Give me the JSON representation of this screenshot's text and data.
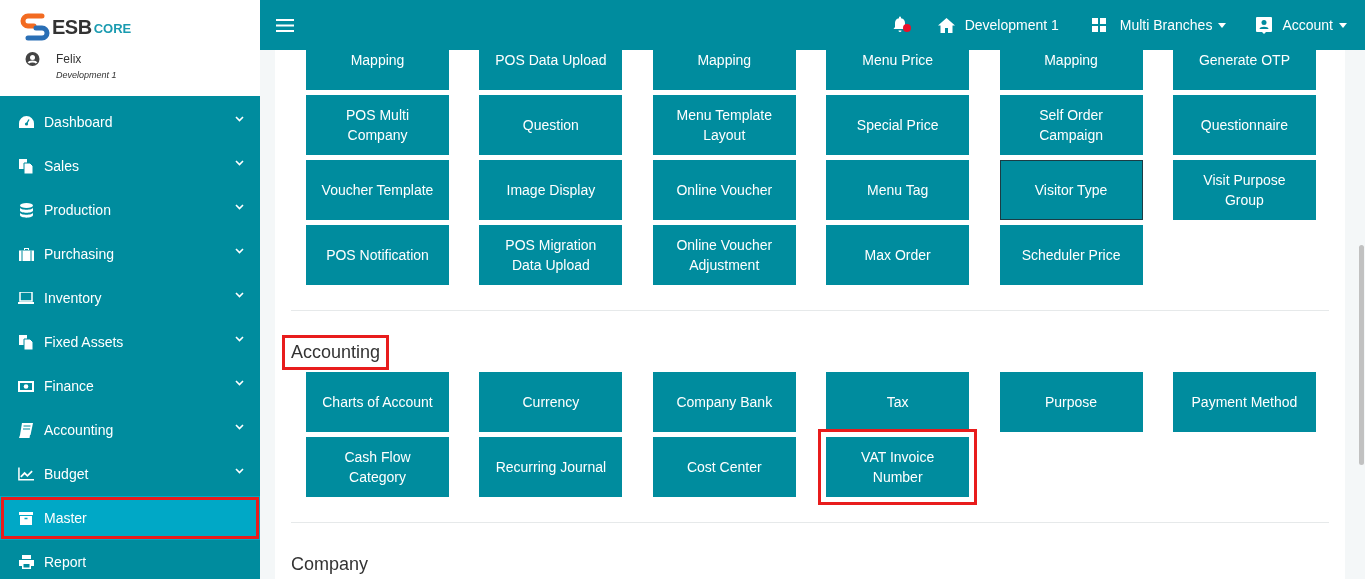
{
  "logo": {
    "text_main": "ESB",
    "text_sub": "CORE"
  },
  "user": {
    "name": "Felix",
    "branch": "Development 1"
  },
  "sidebar": {
    "items": [
      {
        "label": "Dashboard",
        "expandable": true,
        "selected": false,
        "highlighted": false
      },
      {
        "label": "Sales",
        "expandable": true,
        "selected": false,
        "highlighted": false
      },
      {
        "label": "Production",
        "expandable": true,
        "selected": false,
        "highlighted": false
      },
      {
        "label": "Purchasing",
        "expandable": true,
        "selected": false,
        "highlighted": false
      },
      {
        "label": "Inventory",
        "expandable": true,
        "selected": false,
        "highlighted": false
      },
      {
        "label": "Fixed Assets",
        "expandable": true,
        "selected": false,
        "highlighted": false
      },
      {
        "label": "Finance",
        "expandable": true,
        "selected": false,
        "highlighted": false
      },
      {
        "label": "Accounting",
        "expandable": true,
        "selected": false,
        "highlighted": false
      },
      {
        "label": "Budget",
        "expandable": true,
        "selected": false,
        "highlighted": false
      },
      {
        "label": "Master",
        "expandable": false,
        "selected": true,
        "highlighted": true
      },
      {
        "label": "Report",
        "expandable": false,
        "selected": false,
        "highlighted": false
      }
    ]
  },
  "header": {
    "notifications": {
      "unread": true
    },
    "branch": "Development 1",
    "branches_menu": "Multi Branches",
    "account_menu": "Account"
  },
  "sections": [
    {
      "tiles": [
        {
          "label": "Mapping",
          "focused": false,
          "highlighted": false
        },
        {
          "label": "POS Data Upload",
          "focused": false,
          "highlighted": false
        },
        {
          "label": "Mapping",
          "focused": false,
          "highlighted": false
        },
        {
          "label": "Menu Price",
          "focused": false,
          "highlighted": false
        },
        {
          "label": "Mapping",
          "focused": false,
          "highlighted": false
        },
        {
          "label": "Generate OTP",
          "focused": false,
          "highlighted": false
        },
        {
          "label": "POS Multi Company",
          "focused": false,
          "highlighted": false
        },
        {
          "label": "Question",
          "focused": false,
          "highlighted": false
        },
        {
          "label": "Menu Template Layout",
          "focused": false,
          "highlighted": false
        },
        {
          "label": "Special Price",
          "focused": false,
          "highlighted": false
        },
        {
          "label": "Self Order Campaign",
          "focused": false,
          "highlighted": false
        },
        {
          "label": "Questionnaire",
          "focused": false,
          "highlighted": false
        },
        {
          "label": "Voucher Template",
          "focused": false,
          "highlighted": false
        },
        {
          "label": "Image Display",
          "focused": false,
          "highlighted": false
        },
        {
          "label": "Online Voucher",
          "focused": false,
          "highlighted": false
        },
        {
          "label": "Menu Tag",
          "focused": false,
          "highlighted": false
        },
        {
          "label": "Visitor Type",
          "focused": true,
          "highlighted": false
        },
        {
          "label": "Visit Purpose Group",
          "focused": false,
          "highlighted": false
        },
        {
          "label": "POS Notification",
          "focused": false,
          "highlighted": false
        },
        {
          "label": "POS Migration Data Upload",
          "focused": false,
          "highlighted": false
        },
        {
          "label": "Online Voucher Adjustment",
          "focused": false,
          "highlighted": false
        },
        {
          "label": "Max Order",
          "focused": false,
          "highlighted": false
        },
        {
          "label": "Scheduler Price",
          "focused": false,
          "highlighted": false
        }
      ]
    },
    {
      "title": "Accounting",
      "highlighted": true,
      "tiles": [
        {
          "label": "Charts of Account",
          "focused": false,
          "highlighted": false
        },
        {
          "label": "Currency",
          "focused": false,
          "highlighted": false
        },
        {
          "label": "Company Bank",
          "focused": false,
          "highlighted": false
        },
        {
          "label": "Tax",
          "focused": false,
          "highlighted": false
        },
        {
          "label": "Purpose",
          "focused": false,
          "highlighted": false
        },
        {
          "label": "Payment Method",
          "focused": false,
          "highlighted": false
        },
        {
          "label": "Cash Flow Category",
          "focused": false,
          "highlighted": false
        },
        {
          "label": "Recurring Journal",
          "focused": false,
          "highlighted": false
        },
        {
          "label": "Cost Center",
          "focused": false,
          "highlighted": false
        },
        {
          "label": "VAT Invoice Number",
          "focused": false,
          "highlighted": true
        }
      ]
    },
    {
      "title": "Company",
      "highlighted": false
    }
  ]
}
